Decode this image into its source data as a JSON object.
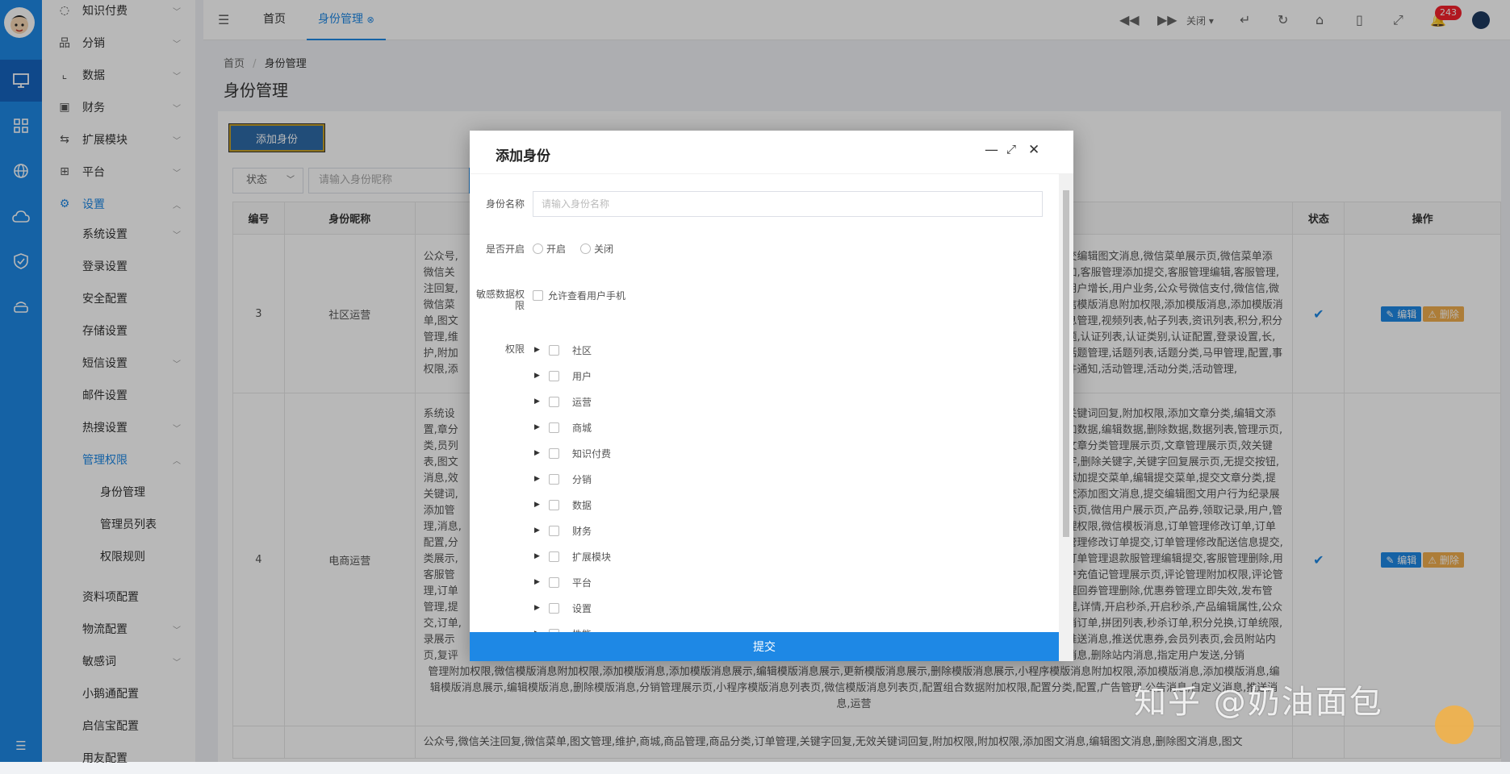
{
  "iconbar": {
    "items": [
      "monitor-icon",
      "grid-icon",
      "globe-icon",
      "cloud-icon",
      "shield-icon",
      "router-icon"
    ],
    "bottom": "menu-fold-icon"
  },
  "sidebar": {
    "items": [
      {
        "label": "知识付费",
        "icon": "bulb-icon",
        "expandable": true
      },
      {
        "label": "分销",
        "icon": "sitemap-icon",
        "expandable": true
      },
      {
        "label": "数据",
        "icon": "chart-icon",
        "expandable": true
      },
      {
        "label": "财务",
        "icon": "wallet-icon",
        "expandable": true
      },
      {
        "label": "扩展模块",
        "icon": "extend-icon",
        "expandable": true
      },
      {
        "label": "平台",
        "icon": "platform-icon",
        "expandable": true
      },
      {
        "label": "设置",
        "icon": "gear-icon",
        "expandable": true,
        "open": true
      }
    ],
    "settings_children": [
      {
        "label": "系统设置",
        "expandable": true
      },
      {
        "label": "登录设置",
        "expandable": false
      },
      {
        "label": "安全配置",
        "expandable": false
      },
      {
        "label": "存储设置",
        "expandable": false
      },
      {
        "label": "短信设置",
        "expandable": true
      },
      {
        "label": "邮件设置",
        "expandable": false
      },
      {
        "label": "热搜设置",
        "expandable": true
      },
      {
        "label": "管理权限",
        "expandable": true,
        "open": true
      }
    ],
    "perm_children": [
      "身份管理",
      "管理员列表",
      "权限规则"
    ],
    "after_items": [
      {
        "label": "资料项配置",
        "expandable": false
      },
      {
        "label": "物流配置",
        "expandable": true
      },
      {
        "label": "敏感词",
        "expandable": true
      },
      {
        "label": "小鹅通配置",
        "expandable": false
      },
      {
        "label": "启信宝配置",
        "expandable": false
      },
      {
        "label": "用友配置",
        "expandable": false
      }
    ]
  },
  "topbar": {
    "tabs": [
      {
        "label": "首页"
      },
      {
        "label": "身份管理"
      }
    ],
    "close_label": "关闭",
    "notification_count": "243"
  },
  "page": {
    "breadcrumb_home": "首页",
    "breadcrumb_sep": "/",
    "breadcrumb_current": "身份管理",
    "title": "身份管理",
    "add_button": "添加身份",
    "filter_status": "状态",
    "search_placeholder": "请输入身份昵称"
  },
  "table": {
    "headers": {
      "id": "编号",
      "name": "身份昵称",
      "status": "状态",
      "ops": "操作"
    },
    "edit_label": "编辑",
    "delete_label": "删除",
    "rows": [
      {
        "id": "3",
        "name": "社区运营",
        "left": "公众号,微信关注回复,微信菜单,图文管理,维护,附加权限,添加图文消息,编辑图文消息,删除图文消息,管理编辑,用户附加权限,添加模版消息,模版消息展示页,附加权限,添加模版消息,分编辑,客服管理,小程序,推送消息,马甲列表",
        "right": "交编辑图文消息,微信菜单展示页,微信菜单添加,客服管理添加提交,客服管理编辑,客服管理,用户增长,用户业务,公众号微信支付,微信信,微信模版消息附加权限,添加模版消息,添加模版消息管理,视频列表,帖子列表,资讯列表,积分,积分题,认证列表,认证类别,认证配置,登录设置,长,话题管理,话题列表,话题分类,马甲管理,配置,事件通知,活动管理,活动分类,活动管理,"
      },
      {
        "id": "4",
        "name": "电商运营",
        "left": "系统设置,章分类,员列表,图文消息,效关键词,添加管理,消息,配置,分类展示,客服管理,订单管理,提交,订单,录展示页,复评论,拼团产品,号配置,计,产品,加权限,",
        "right": "关键词回复,附加权限,添加文章分类,编辑文添加数据,编辑数据,删除数据,数据列表,管理示页,文章分类管理展示页,文章管理展示页,效关键字,删除关键字,关键字回复展示页,无提交按钮,添加提交菜单,编辑提交菜单,提交文章分类,提交添加图文消息,提交编辑图文用户行为纪录展示页,微信用户展示页,产品券,领取记录,用户,管理权限,微信模板消息,订单管理修改订单,订单管理修改订单提交,订单管理修改配送信息提交,订单管理退款服管理编辑提交,客服管理删除,用户充值记管理展示页,评论管理附加权限,评论管理回券管理删除,优惠券管理立即失效,发布管理,详情,开启秒杀,开启秒杀,产品编辑属性,公众消订单,拼团列表,秒杀订单,积分兑换,订单统限,推送消息,推送优惠券,会员列表页,会员附站内消息,删除站内消息,指定用户发送,分销",
        "tail": "管理附加权限,微信模版消息附加权限,添加模版消息,添加模版消息展示,编辑模版消息展示,更新模版消息展示,删除模版消息展示,小程序模版消息附加权限,添加模版消息,添加模版消息,编辑模版消息展示,编辑模版消息,删除模版消息,分销管理展示页,小程序模版消息列表页,微信模版消息列表页,配置组合数据附加权限,配置分类,配置,广告管理,公告消息,自定义消息,推送消息,运营"
      },
      {
        "id": "",
        "name": "",
        "left": "公众号,微信关注回复,微信菜单,图文管理,维护,商城,商品管理,商品分类,订单管理,关键字回复,无效关键词回复,附加权限,附加权限,添加图文消息,编辑图文消息,删除图文消息,图文"
      }
    ]
  },
  "modal": {
    "title": "添加身份",
    "name_label": "身份名称",
    "name_placeholder": "请输入身份名称",
    "open_label": "是否开启",
    "open_on": "开启",
    "open_off": "关闭",
    "sensitive_label": "敏感数据权限",
    "sensitive_option": "允许查看用户手机",
    "perm_label": "权限",
    "perm_tree": [
      "社区",
      "用户",
      "运营",
      "商城",
      "知识付费",
      "分销",
      "数据",
      "财务",
      "扩展模块",
      "平台",
      "设置",
      "性能"
    ],
    "submit": "提交"
  },
  "watermark": "知乎 @奶油面包"
}
